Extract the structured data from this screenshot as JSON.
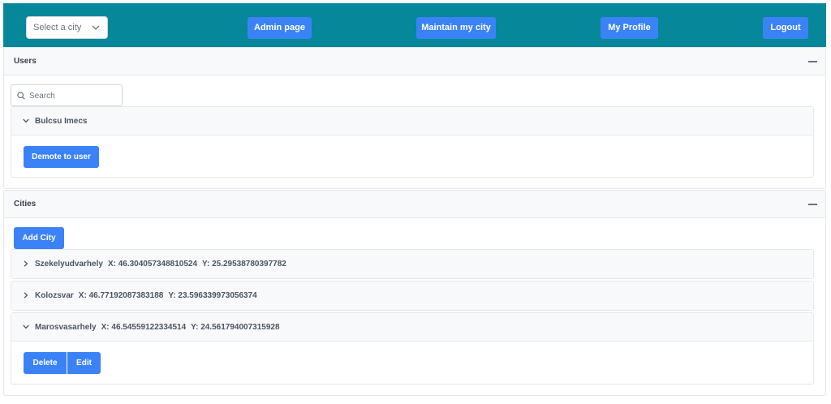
{
  "header": {
    "city_select": {
      "placeholder": "Select a city"
    },
    "admin_label": "Admin page",
    "maintain_label": "Maintain my city",
    "profile_label": "My Profile",
    "logout_label": "Logout"
  },
  "users": {
    "title": "Users",
    "search_placeholder": "Search",
    "list": [
      {
        "name": "Bulcsu Imecs",
        "action_label": "Demote to user"
      }
    ]
  },
  "cities": {
    "title": "Cities",
    "add_label": "Add City",
    "list": [
      {
        "name": "Szekelyudvarhely",
        "x": "X: 46.304057348810524",
        "y": "Y: 25.29538780397782"
      },
      {
        "name": "Kolozsvar",
        "x": "X: 46.77192087383188",
        "y": "Y: 23.596339973056374"
      },
      {
        "name": "Marosvasarhely",
        "x": "X: 46.54559122334514",
        "y": "Y: 24.561794007315928"
      }
    ],
    "delete_label": "Delete",
    "edit_label": "Edit"
  },
  "colors": {
    "header_bg": "#06879a",
    "primary": "#3b82f6"
  }
}
